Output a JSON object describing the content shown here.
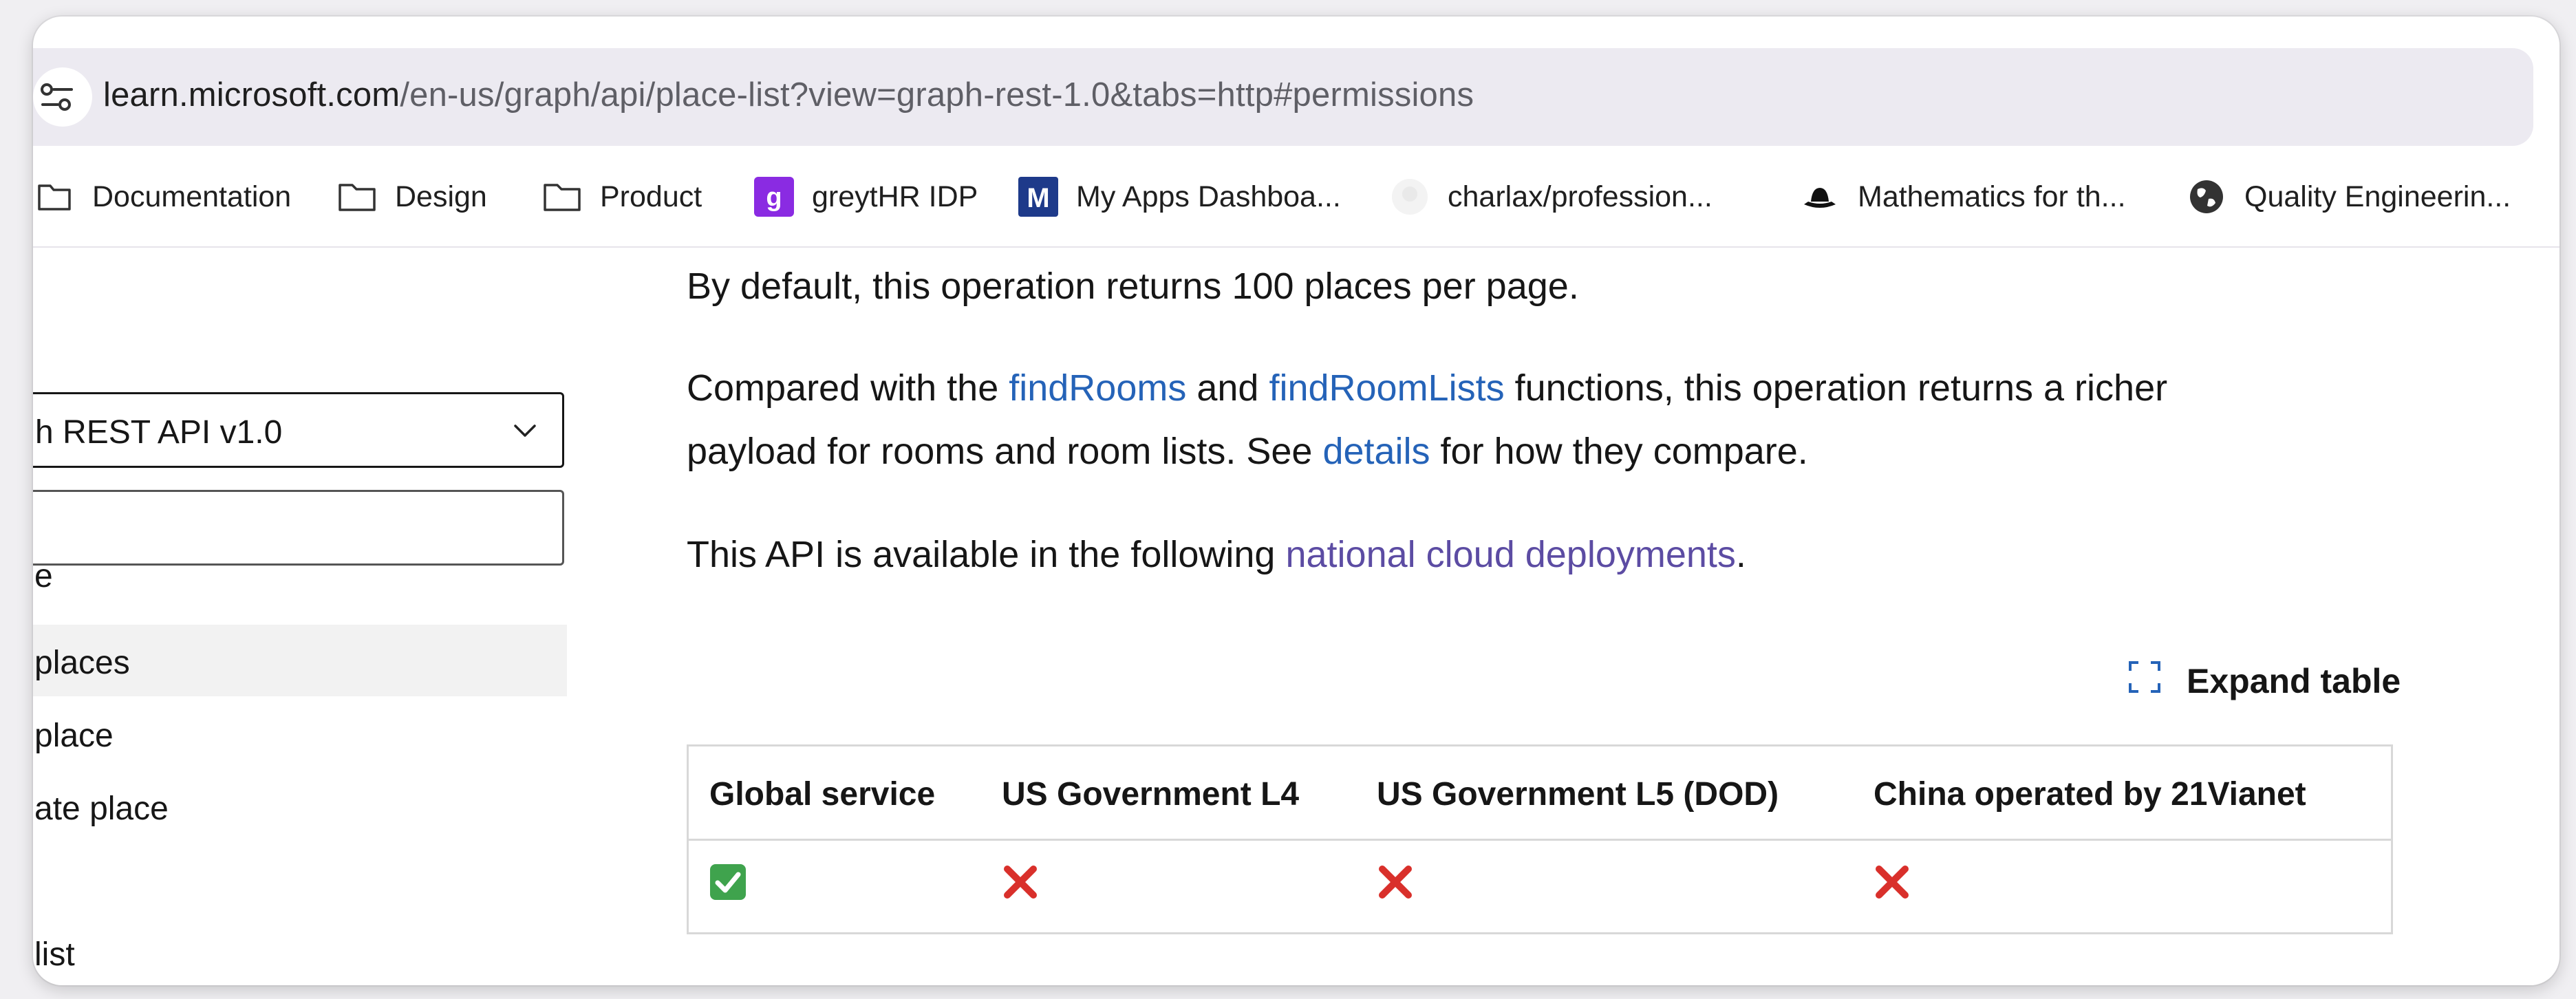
{
  "address_bar": {
    "domain": "learn.microsoft.com",
    "path": "/en-us/graph/api/place-list?view=graph-rest-1.0&tabs=http#permissions"
  },
  "bookmarks": [
    {
      "label": "Documentation",
      "icon": "folder-icon"
    },
    {
      "label": "Design",
      "icon": "folder-icon"
    },
    {
      "label": "Product",
      "icon": "folder-icon"
    },
    {
      "label": "greytHR IDP",
      "icon": "greythr-icon"
    },
    {
      "label": "My Apps Dashboa...",
      "icon": "myapps-icon"
    },
    {
      "label": "charlax/profession...",
      "icon": "github-icon"
    },
    {
      "label": "Mathematics for th...",
      "icon": "hat-icon"
    },
    {
      "label": "Quality Engineerin...",
      "icon": "globe-icon"
    }
  ],
  "left_nav": {
    "version_select": "h REST API v1.0",
    "filter_value": "e",
    "items": [
      {
        "label": "e"
      },
      {
        "label": "places",
        "active": true
      },
      {
        "label": "place"
      },
      {
        "label": "ate place"
      },
      {
        "label": "list"
      }
    ]
  },
  "content": {
    "p1": "By default, this operation returns 100 places per page.",
    "p2_a": "Compared with the ",
    "p2_link1": "findRooms",
    "p2_b": " and ",
    "p2_link2": "findRoomLists",
    "p2_c": " functions, this operation returns a richer",
    "p2_d": "payload for rooms and room lists. See ",
    "p2_link3": "details",
    "p2_e": " for how they compare.",
    "p3_a": "This API is available in the following ",
    "p3_link": "national cloud deployments",
    "p3_b": ".",
    "expand_label": "Expand table"
  },
  "table": {
    "headers": [
      "Global service",
      "US Government L4",
      "US Government L5 (DOD)",
      "China operated by 21Vianet"
    ],
    "cells": [
      "check-mark-icon",
      "cross-mark-icon",
      "cross-mark-icon",
      "cross-mark-icon"
    ]
  },
  "colors": {
    "link": "#2563b8",
    "visited_link": "#5c4ca3",
    "check": "#3fa34d",
    "cross": "#d9302b"
  }
}
